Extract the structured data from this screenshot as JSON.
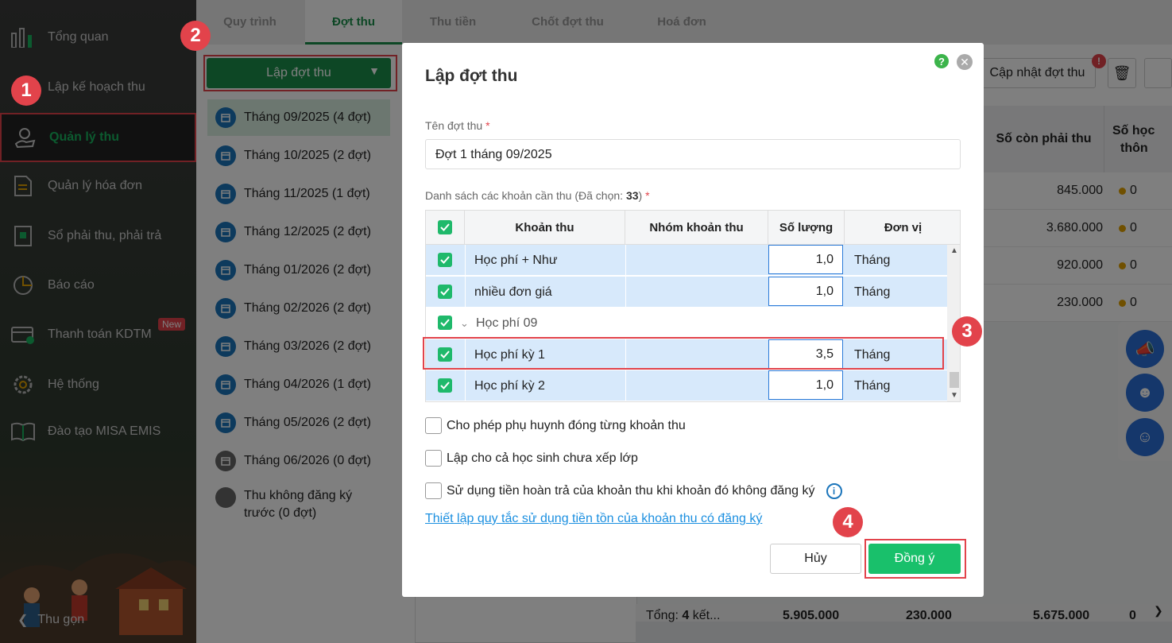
{
  "sidebar": {
    "items": [
      {
        "label": "Tổng quan",
        "icon": "bar-chart-icon"
      },
      {
        "label": "Lập kế hoạch thu",
        "icon": "plan-icon"
      },
      {
        "label": "Quản lý thu",
        "icon": "money-hand-icon"
      },
      {
        "label": "Quản lý hóa đơn",
        "icon": "invoice-icon"
      },
      {
        "label": "Sổ phải thu, phải trả",
        "icon": "ledger-icon"
      },
      {
        "label": "Báo cáo",
        "icon": "pie-chart-icon"
      },
      {
        "label": "Thanh toán KDTM",
        "icon": "card-icon"
      },
      {
        "label": "Hệ thống",
        "icon": "gear-icon"
      },
      {
        "label": "Đào tạo MISA EMIS",
        "icon": "book-icon"
      }
    ],
    "new_badge": "New",
    "collapse_label": "Thu gọn"
  },
  "steps": [
    "1",
    "2",
    "3",
    "4"
  ],
  "tabs": [
    "Quy trình",
    "Đợt thu",
    "Thu tiền",
    "Chốt đợt thu",
    "Hoá đơn"
  ],
  "left_panel": {
    "create_button": "Lập đợt thu",
    "periods": [
      "Tháng 09/2025 (4 đợt)",
      "Tháng 10/2025 (2 đợt)",
      "Tháng 11/2025 (1 đợt)",
      "Tháng 12/2025 (2 đợt)",
      "Tháng 01/2026 (2 đợt)",
      "Tháng 02/2026 (2 đợt)",
      "Tháng 03/2026 (2 đợt)",
      "Tháng 04/2026 (1 đợt)",
      "Tháng 05/2026 (2 đợt)",
      "Tháng 06/2026 (0 đợt)"
    ],
    "unregistered_line1": "Thu không đăng ký",
    "unregistered_line2": "trước (0 đợt)"
  },
  "right": {
    "update_button": "Cập nhật đợt thu",
    "col_remaining": "Số còn phải thu",
    "col_notify_1": "Số học",
    "col_notify_2": "thôn",
    "rows": [
      {
        "remaining": "845.000",
        "count": "0"
      },
      {
        "remaining": "3.680.000",
        "count": "0"
      },
      {
        "remaining": "920.000",
        "count": "0"
      },
      {
        "remaining": "230.000",
        "count": "0"
      }
    ],
    "footer": {
      "total_label": "Tổng:",
      "total_count": "4",
      "total_suffix": "kết...",
      "v1": "5.905.000",
      "v2": "230.000",
      "v3": "5.675.000",
      "v4": "0"
    }
  },
  "modal": {
    "title": "Lập đợt thu",
    "help": "?",
    "name_label": "Tên đợt thu",
    "name_value": "Đợt 1 tháng 09/2025",
    "list_label": "Danh sách các khoản cần thu (Đã chọn:",
    "list_count": "33",
    "list_close": ")",
    "required_mark": "*",
    "columns": [
      "Khoản thu",
      "Nhóm khoản thu",
      "Số lượng",
      "Đơn vị"
    ],
    "rows": [
      {
        "name": "Học phí + Như",
        "qty": "1,0",
        "unit": "Tháng"
      },
      {
        "name": "nhiều đơn giá",
        "qty": "1,0",
        "unit": "Tháng"
      },
      {
        "group": "Học phí 09"
      },
      {
        "name": "Học phí kỳ 1",
        "qty": "3,5",
        "unit": "Tháng"
      },
      {
        "name": "Học phí kỳ 2",
        "qty": "1,0",
        "unit": "Tháng"
      }
    ],
    "options": [
      "Cho phép phụ huynh đóng từng khoản thu",
      "Lập cho cả học sinh chưa xếp lớp",
      "Sử dụng tiền hoàn trả của khoản thu khi khoản đó không đăng ký"
    ],
    "link": "Thiết lập quy tắc sử dụng tiền tồn của khoản thu có đăng ký",
    "cancel": "Hủy",
    "ok": "Đồng ý"
  }
}
